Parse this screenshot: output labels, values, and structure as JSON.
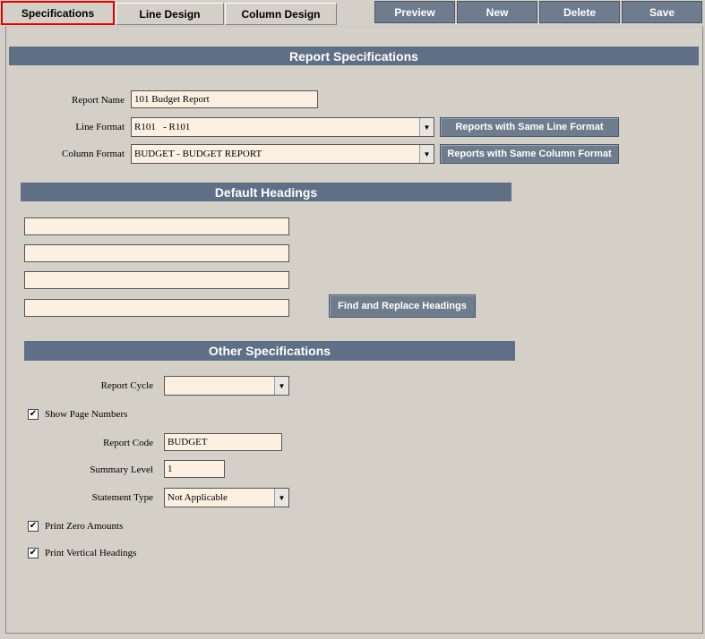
{
  "tabs": [
    {
      "label": "Specifications"
    },
    {
      "label": "Line Design"
    },
    {
      "label": "Column Design"
    }
  ],
  "actions": {
    "preview": "Preview",
    "new": "New",
    "delete": "Delete",
    "save": "Save"
  },
  "report_specs": {
    "title": "Report Specifications",
    "report_name_label": "Report Name",
    "report_name_value": "101 Budget Report",
    "line_format_label": "Line Format",
    "line_format_value": "R101   - R101",
    "column_format_label": "Column Format",
    "column_format_value": "BUDGET - BUDGET REPORT",
    "same_line_btn": "Reports with Same Line Format",
    "same_column_btn": "Reports with Same Column Format"
  },
  "default_headings": {
    "title": "Default Headings",
    "headings": [
      "",
      "",
      "",
      ""
    ],
    "find_replace_btn": "Find and Replace Headings"
  },
  "other_specs": {
    "title": "Other Specifications",
    "report_cycle_label": "Report Cycle",
    "report_cycle_value": "",
    "show_page_numbers_label": "Show Page Numbers",
    "show_page_numbers_checked": true,
    "report_code_label": "Report Code",
    "report_code_value": "BUDGET",
    "summary_level_label": "Summary Level",
    "summary_level_value": "1",
    "statement_type_label": "Statement Type",
    "statement_type_value": "Not Applicable",
    "print_zero_label": "Print Zero Amounts",
    "print_zero_checked": true,
    "print_vertical_label": "Print Vertical Headings",
    "print_vertical_checked": true
  },
  "icons": {
    "dropdown": "chevron-down-icon",
    "check": "checkmark-icon"
  },
  "colors": {
    "section_bar": "#5f6f85",
    "action_button": "#6e7c8e",
    "field_bg": "#fbf0e1",
    "active_tab_border": "#e00000"
  }
}
